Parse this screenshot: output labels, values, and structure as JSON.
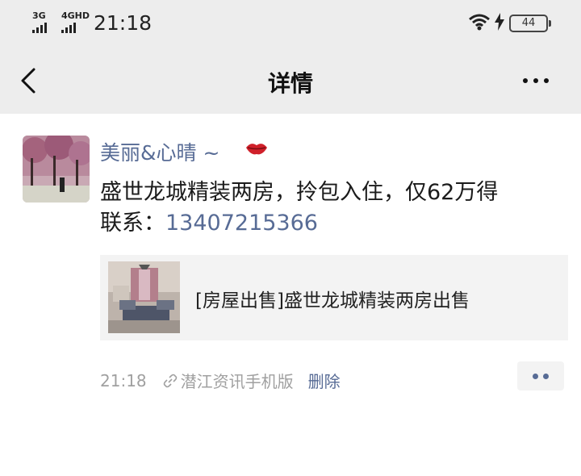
{
  "status_bar": {
    "signal1_label": "3G",
    "signal2_label": "4GHD",
    "time": "21:18",
    "battery": "44"
  },
  "nav": {
    "title": "详情"
  },
  "post": {
    "author": "美丽&心晴 ~",
    "content_line1": "盛世龙城精装两房，拎包入住，仅62万得",
    "contact_label": "联系：",
    "phone": "13407215366",
    "link_card_title": "[房屋出售]盛世龙城精装两房出售",
    "time": "21:18",
    "source": "潜江资讯手机版",
    "delete_label": "删除"
  }
}
